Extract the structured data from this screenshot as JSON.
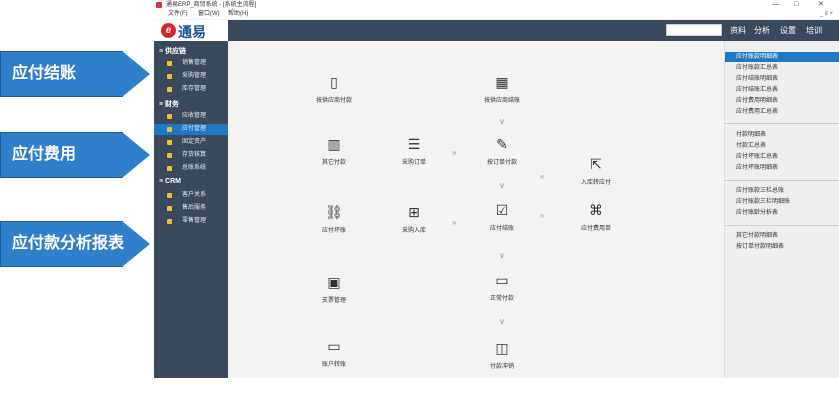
{
  "callouts": [
    "应付结账",
    "应付费用",
    "应付款分析报表"
  ],
  "window": {
    "title": "通易ERP_商贸系统 - [系统主流程]",
    "menu": [
      "文件(F)",
      "窗口(W)",
      "帮助(H)"
    ],
    "menu_right": "_ ♯ ×"
  },
  "logo": {
    "text": "通易",
    "mark": "e"
  },
  "topnav": [
    "资料",
    "分析",
    "设置",
    "培训"
  ],
  "sidebar": {
    "sections": [
      {
        "title": "供应链",
        "items": [
          "销售管理",
          "采购管理",
          "库存管理"
        ]
      },
      {
        "title": "财务",
        "items": [
          "应收管理",
          "应付管理",
          "固定资产",
          "存货核算",
          "总账系统"
        ]
      },
      {
        "title": "CRM",
        "items": [
          "客户关系",
          "售后服务",
          "零售管理"
        ]
      }
    ],
    "active": "应付管理"
  },
  "flow": {
    "nodes": {
      "by_supplier_payment": {
        "label": "按供应商付款",
        "icon": "tablet-icon"
      },
      "by_supplier_settle": {
        "label": "按供应商结账",
        "icon": "grid-icon"
      },
      "other_payment": {
        "label": "其它付款",
        "icon": "building-icon"
      },
      "purchase_order": {
        "label": "采购订单",
        "icon": "list-icon"
      },
      "order_payment": {
        "label": "按订单付款",
        "icon": "edit-icon"
      },
      "inbound_to_payable": {
        "label": "入库转应付",
        "icon": "share-icon"
      },
      "payable_badloan": {
        "label": "应付坏账",
        "icon": "unlink-icon"
      },
      "purchase_inbound": {
        "label": "采购入库",
        "icon": "calendar-plus-icon"
      },
      "payable_settle": {
        "label": "应付结账",
        "icon": "check-square-icon"
      },
      "payable_expense": {
        "label": "应付费用单",
        "icon": "file-code-icon"
      },
      "check_management": {
        "label": "支票管理",
        "icon": "money-icon"
      },
      "normal_payment": {
        "label": "正常付款",
        "icon": "card-icon"
      },
      "account_transfer": {
        "label": "账户转账",
        "icon": "card-icon"
      },
      "payment_offset": {
        "label": "付款冲销",
        "icon": "columns-icon"
      }
    }
  },
  "right_panel": {
    "groups": [
      [
        "应付账款明细表",
        "应付账款汇总表",
        "应付结账明细表",
        "应付结账汇总表",
        "应付费用明细表",
        "应付费用汇总表"
      ],
      [
        "付款明细表",
        "付款汇总表",
        "应付坏账汇总表",
        "应付坏账明细表"
      ],
      [
        "应付账款三栏总账",
        "应付账款三栏明细账",
        "应付账龄分析表"
      ],
      [
        "其它付款明细表",
        "按订单付款明细表"
      ]
    ],
    "active": "应付账款明细表"
  }
}
